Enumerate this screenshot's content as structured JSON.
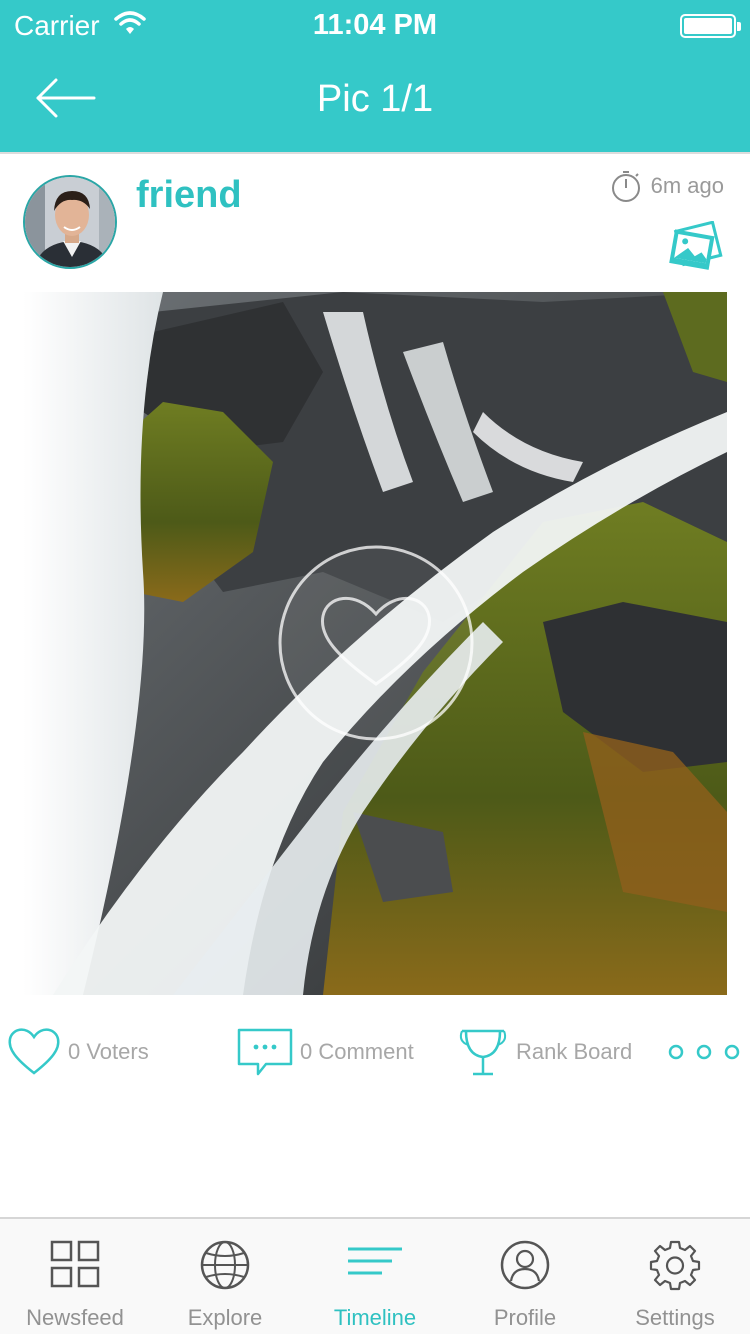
{
  "status_bar": {
    "carrier": "Carrier",
    "time": "11:04 PM"
  },
  "nav": {
    "title": "Pic 1/1",
    "back_icon": "arrow-left-icon"
  },
  "post": {
    "username": "friend",
    "time_ago": "6m ago",
    "timer_icon": "stopwatch-icon",
    "gallery_icon": "photo-gallery-icon"
  },
  "actions": {
    "voters": "0 Voters",
    "comment": "0 Comment",
    "rank_board": "Rank Board"
  },
  "tabs": [
    {
      "label": "Newsfeed",
      "icon": "grid-icon"
    },
    {
      "label": "Explore",
      "icon": "globe-icon"
    },
    {
      "label": "Timeline",
      "icon": "timeline-icon",
      "active": true
    },
    {
      "label": "Profile",
      "icon": "profile-icon"
    },
    {
      "label": "Settings",
      "icon": "gear-icon"
    }
  ],
  "colors": {
    "accent": "#35c9c9",
    "accent_text": "#2fc1c1",
    "muted_text": "#a7a7a7"
  }
}
